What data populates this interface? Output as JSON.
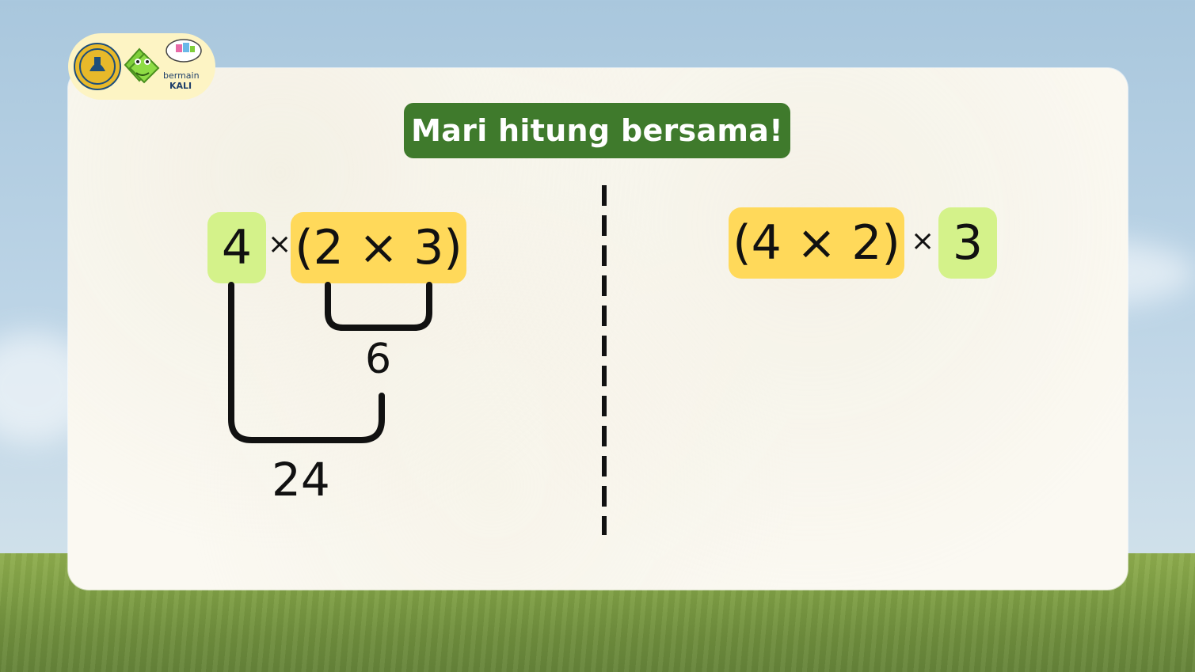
{
  "title": "Mari hitung bersama!",
  "logo": {
    "brand_line1": "bermain",
    "brand_line2": "KALI"
  },
  "left": {
    "a": "4",
    "times": "×",
    "group": "(2 × 3)",
    "inner_result": "6",
    "outer_result": "24"
  },
  "right": {
    "group": "(4 × 2)",
    "times": "×",
    "b": "3"
  },
  "colors": {
    "green_box": "#d4f28a",
    "yellow_box": "#ffd95a",
    "title_bg": "#3f7a2c"
  }
}
